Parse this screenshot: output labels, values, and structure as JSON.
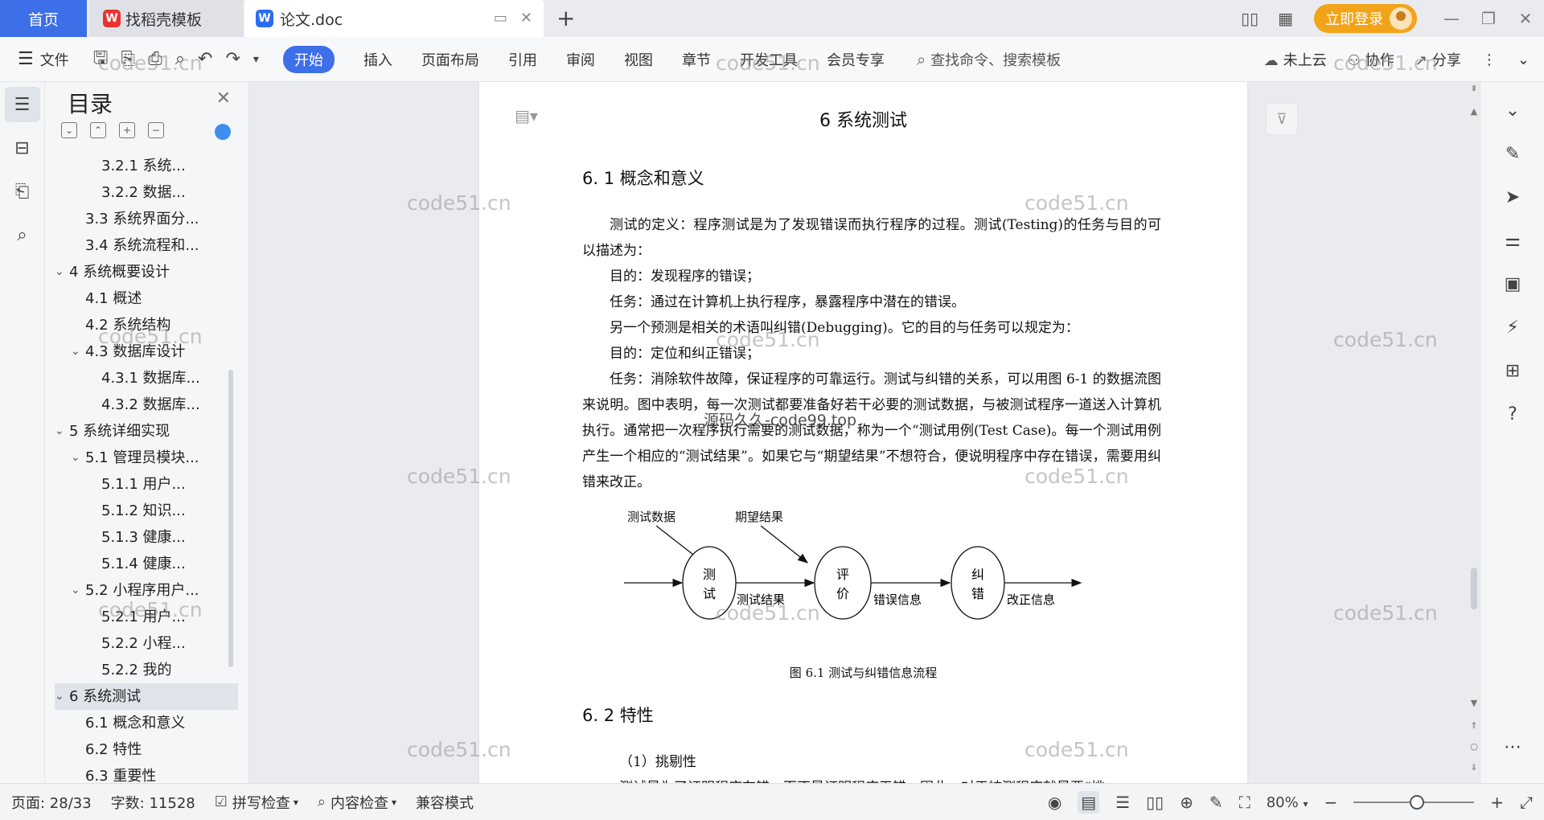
{
  "tabs": {
    "home": "首页",
    "templates": "找稻壳模板",
    "doc": "论文.doc"
  },
  "window": {
    "login_label": "立即登录"
  },
  "ribbon": {
    "file_label": "文件",
    "tabs": [
      "开始",
      "插入",
      "页面布局",
      "引用",
      "审阅",
      "视图",
      "章节",
      "开发工具",
      "会员专享"
    ],
    "search_placeholder": "查找命令、搜索模板",
    "cloud_label": "未上云",
    "collab_label": "协作",
    "share_label": "分享"
  },
  "toc": {
    "title": "目录",
    "items": [
      {
        "text": "3.2.1 系统...",
        "level": 3
      },
      {
        "text": "3.2.2 数据...",
        "level": 3
      },
      {
        "text": "3.3 系统界面分...",
        "level": 2
      },
      {
        "text": "3.4 系统流程和...",
        "level": 2
      },
      {
        "text": "4 系统概要设计",
        "level": 1,
        "expanded": true
      },
      {
        "text": "4.1 概述",
        "level": 2
      },
      {
        "text": "4.2 系统结构",
        "level": 2
      },
      {
        "text": "4.3 数据库设计",
        "level": 2,
        "expanded": true
      },
      {
        "text": "4.3.1 数据库...",
        "level": 3
      },
      {
        "text": "4.3.2 数据库...",
        "level": 3
      },
      {
        "text": "5 系统详细实现",
        "level": 1,
        "expanded": true
      },
      {
        "text": "5.1 管理员模块...",
        "level": 2,
        "expanded": true
      },
      {
        "text": "5.1.1 用户...",
        "level": 3
      },
      {
        "text": "5.1.2 知识...",
        "level": 3
      },
      {
        "text": "5.1.3 健康...",
        "level": 3
      },
      {
        "text": "5.1.4 健康...",
        "level": 3
      },
      {
        "text": "5.2 小程序用户...",
        "level": 2,
        "expanded": true
      },
      {
        "text": "5.2.1 用户...",
        "level": 3
      },
      {
        "text": "5.2.2 小程...",
        "level": 3
      },
      {
        "text": "5.2.2 我的",
        "level": 3
      },
      {
        "text": "6 系统测试",
        "level": 1,
        "expanded": true,
        "selected": true
      },
      {
        "text": "6.1 概念和意义",
        "level": 2
      },
      {
        "text": "6.2 特性",
        "level": 2
      },
      {
        "text": "6.3 重要性",
        "level": 2
      }
    ]
  },
  "document": {
    "chapter_title": "6 系统测试",
    "section1_title": "6. 1 概念和意义",
    "paragraphs": [
      {
        "text": "测试的定义：程序测试是为了发现错误而执行程序的过程。测试(Testing)的任务与目的可以描述为：",
        "indent": true
      },
      {
        "text": "目的：发现程序的错误；",
        "indent": true
      },
      {
        "text": "任务：通过在计算机上执行程序，暴露程序中潜在的错误。",
        "indent": true
      },
      {
        "text": "另一个预测是相关的术语叫纠错(Debugging)。它的目的与任务可以规定为：",
        "indent": true
      },
      {
        "text": "目的：定位和纠正错误；",
        "indent": true
      },
      {
        "text": "任务：消除软件故障，保证程序的可靠运行。测试与纠错的关系，可以用图 6-1 的数据流图来说明。图中表明，每一次测试都要准备好若干必要的测试数据，与被测试程序一道送入计算机执行。通常把一次程序执行需要的测试数据，称为一个“测试用例(Test Case)。每一个测试用例产生一个相应的“测试结果”。如果它与“期望结果”不想符合，便说明程序中存在错误，需要用纠错来改正。",
        "indent": true
      }
    ],
    "diagram": {
      "input_test_data": "测试数据",
      "input_expected": "期望结果",
      "node_test": [
        "测",
        "试"
      ],
      "node_eval": [
        "评",
        "价"
      ],
      "node_fix": [
        "纠",
        "错"
      ],
      "edge_test_result": "测试结果",
      "edge_error_info": "错误信息",
      "edge_fix_info": "改正信息"
    },
    "figure_caption": "图 6.1 测试与纠错信息流程",
    "section2_title": "6. 2 特性",
    "subsection": "（1）挑剔性",
    "cut_line": "测试是为了证明程序有错，而不是证明程序无错。因此，对于被测程序就是要“挑"
  },
  "watermarks": {
    "site": "code51.cn",
    "overlay": "源码久久-code99.top"
  },
  "status": {
    "page": "页面: 28/33",
    "words": "字数: 11528",
    "spellcheck": "拼写检查",
    "content_check": "内容检查",
    "compat_mode": "兼容模式",
    "zoom": "80%"
  }
}
